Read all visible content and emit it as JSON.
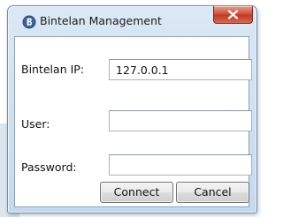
{
  "window": {
    "title": "Bintelan Management",
    "app_icon": "bintelan-app-icon",
    "close_icon": "close-icon"
  },
  "form": {
    "ip_label": "Bintelan IP:",
    "ip_value": "127.0.0.1",
    "user_label": "User:",
    "user_value": "",
    "password_label": "Password:",
    "password_value": ""
  },
  "buttons": {
    "connect_label": "Connect",
    "cancel_label": "Cancel"
  },
  "colors": {
    "frame": "#c5d9ee",
    "close_button": "#c13a24",
    "app_icon": "#2a4f7a"
  }
}
